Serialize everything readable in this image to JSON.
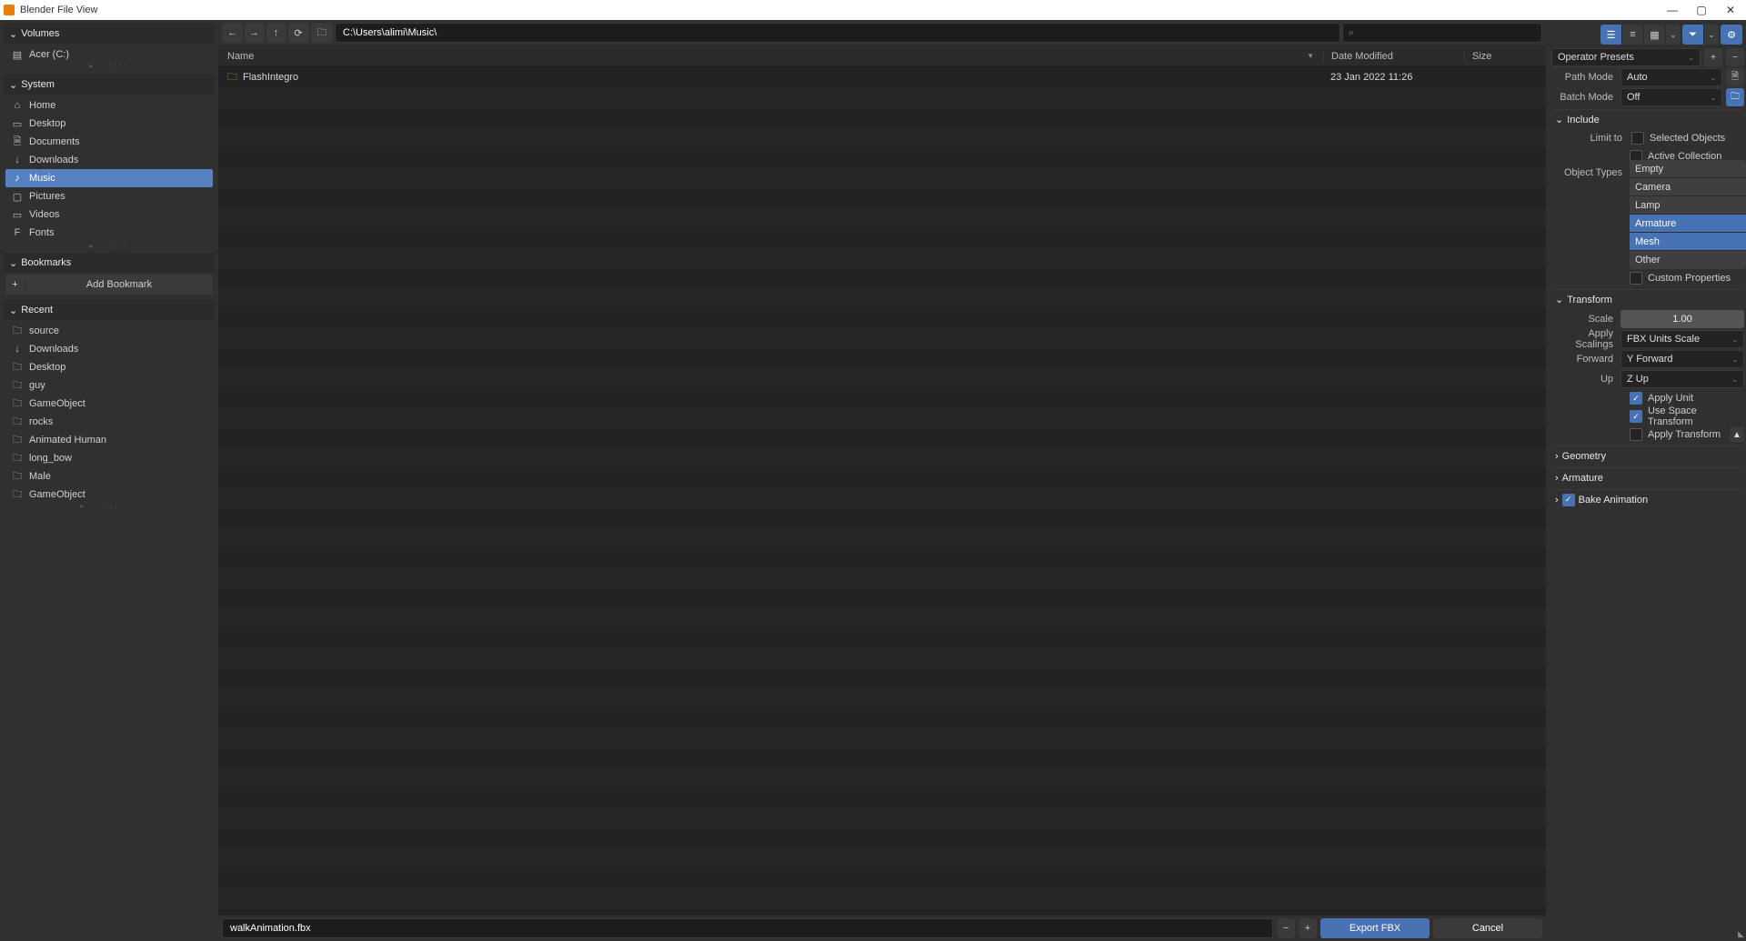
{
  "window": {
    "title": "Blender File View"
  },
  "sidebar": {
    "volumes": {
      "header": "Volumes",
      "items": [
        {
          "label": "Acer (C:)",
          "icon": "▤"
        }
      ]
    },
    "system": {
      "header": "System",
      "items": [
        {
          "label": "Home",
          "icon": "⌂"
        },
        {
          "label": "Desktop",
          "icon": "▭"
        },
        {
          "label": "Documents",
          "icon": "🗎"
        },
        {
          "label": "Downloads",
          "icon": "↓"
        },
        {
          "label": "Music",
          "icon": "♪",
          "selected": true
        },
        {
          "label": "Pictures",
          "icon": "▢"
        },
        {
          "label": "Videos",
          "icon": "▭"
        },
        {
          "label": "Fonts",
          "icon": "F"
        }
      ]
    },
    "bookmarks": {
      "header": "Bookmarks",
      "add_label": "Add Bookmark"
    },
    "recent": {
      "header": "Recent",
      "items": [
        {
          "label": "source",
          "icon": "🗀"
        },
        {
          "label": "Downloads",
          "icon": "↓"
        },
        {
          "label": "Desktop",
          "icon": "🗀"
        },
        {
          "label": "guy",
          "icon": "🗀"
        },
        {
          "label": "GameObject",
          "icon": "🗀"
        },
        {
          "label": "rocks",
          "icon": "🗀"
        },
        {
          "label": "Animated Human",
          "icon": "🗀"
        },
        {
          "label": "long_bow",
          "icon": "🗀"
        },
        {
          "label": "Male",
          "icon": "🗀"
        },
        {
          "label": "GameObject",
          "icon": "🗀"
        }
      ]
    }
  },
  "toolbar": {
    "path": "C:\\Users\\alimi\\Music\\"
  },
  "columns": {
    "name": "Name",
    "date": "Date Modified",
    "size": "Size"
  },
  "files": [
    {
      "name": "FlashIntegro",
      "date": "23 Jan 2022 11:26",
      "size": ""
    }
  ],
  "filename": "walkAnimation.fbx",
  "actions": {
    "export": "Export FBX",
    "cancel": "Cancel"
  },
  "operator": {
    "presets_label": "Operator Presets",
    "path_mode": {
      "label": "Path Mode",
      "value": "Auto"
    },
    "batch_mode": {
      "label": "Batch Mode",
      "value": "Off"
    },
    "include": {
      "header": "Include",
      "limit_to": "Limit to",
      "selected_objects": "Selected Objects",
      "active_collection": "Active Collection",
      "object_types_label": "Object Types",
      "object_types": [
        {
          "label": "Empty",
          "active": false
        },
        {
          "label": "Camera",
          "active": false
        },
        {
          "label": "Lamp",
          "active": false
        },
        {
          "label": "Armature",
          "active": true
        },
        {
          "label": "Mesh",
          "active": true
        },
        {
          "label": "Other",
          "active": false
        }
      ],
      "custom_props": "Custom Properties"
    },
    "transform": {
      "header": "Transform",
      "scale_label": "Scale",
      "scale_value": "1.00",
      "apply_scalings": {
        "label": "Apply Scalings",
        "value": "FBX Units Scale"
      },
      "forward": {
        "label": "Forward",
        "value": "Y Forward"
      },
      "up": {
        "label": "Up",
        "value": "Z Up"
      },
      "apply_unit": "Apply Unit",
      "use_space": "Use Space Transform",
      "apply_transform": "Apply Transform"
    },
    "geometry_header": "Geometry",
    "armature_header": "Armature",
    "bake_anim": "Bake Animation"
  }
}
